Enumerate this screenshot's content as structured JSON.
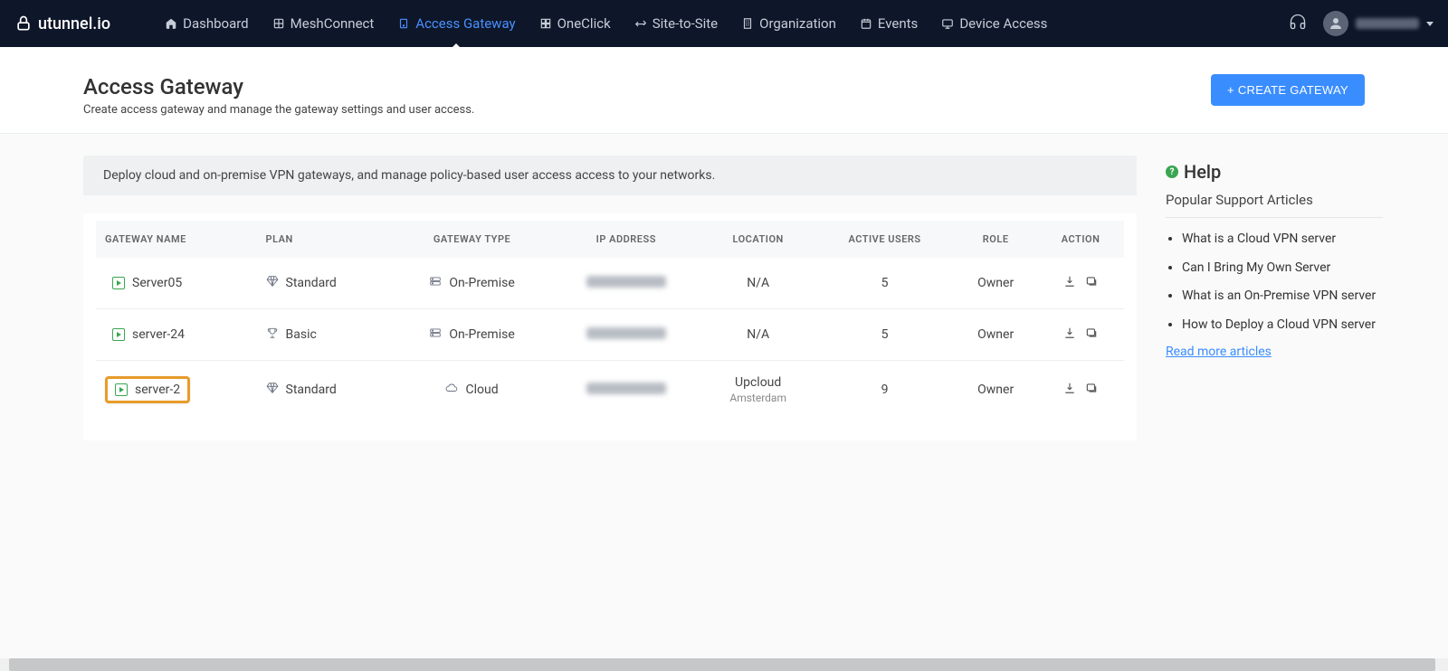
{
  "brand": "utunnel.io",
  "nav": [
    {
      "id": "dashboard",
      "label": "Dashboard"
    },
    {
      "id": "meshconnect",
      "label": "MeshConnect"
    },
    {
      "id": "access-gateway",
      "label": "Access Gateway",
      "active": true
    },
    {
      "id": "oneclick",
      "label": "OneClick"
    },
    {
      "id": "site-to-site",
      "label": "Site-to-Site"
    },
    {
      "id": "organization",
      "label": "Organization"
    },
    {
      "id": "events",
      "label": "Events"
    },
    {
      "id": "device-access",
      "label": "Device Access"
    }
  ],
  "page": {
    "title": "Access Gateway",
    "subtitle": "Create access gateway and manage the gateway settings and user access.",
    "create_btn": "+ CREATE GATEWAY",
    "banner": "Deploy cloud and on-premise VPN gateways, and manage policy-based user access access to your networks."
  },
  "table": {
    "columns": {
      "name": "GATEWAY NAME",
      "plan": "PLAN",
      "type": "GATEWAY TYPE",
      "ip": "IP ADDRESS",
      "location": "LOCATION",
      "users": "ACTIVE USERS",
      "role": "ROLE",
      "action": "ACTION"
    },
    "rows": [
      {
        "name": "Server05",
        "plan": "Standard",
        "plan_icon": "diamond",
        "type": "On-Premise",
        "type_icon": "server",
        "ip_hidden": true,
        "location": "N/A",
        "location_sub": "",
        "users": "5",
        "role": "Owner",
        "highlighted": false
      },
      {
        "name": "server-24",
        "plan": "Basic",
        "plan_icon": "trophy",
        "type": "On-Premise",
        "type_icon": "server",
        "ip_hidden": true,
        "location": "N/A",
        "location_sub": "",
        "users": "5",
        "role": "Owner",
        "highlighted": false
      },
      {
        "name": "server-2",
        "plan": "Standard",
        "plan_icon": "diamond",
        "type": "Cloud",
        "type_icon": "cloud",
        "ip_hidden": true,
        "location": "Upcloud",
        "location_sub": "Amsterdam",
        "users": "9",
        "role": "Owner",
        "highlighted": true
      }
    ]
  },
  "help": {
    "title": "Help",
    "subtitle": "Popular Support Articles",
    "articles": [
      "What is a Cloud VPN server",
      "Can I Bring My Own Server",
      "What is an On-Premise VPN server",
      "How to Deploy a Cloud VPN server"
    ],
    "read_more": "Read more articles"
  }
}
